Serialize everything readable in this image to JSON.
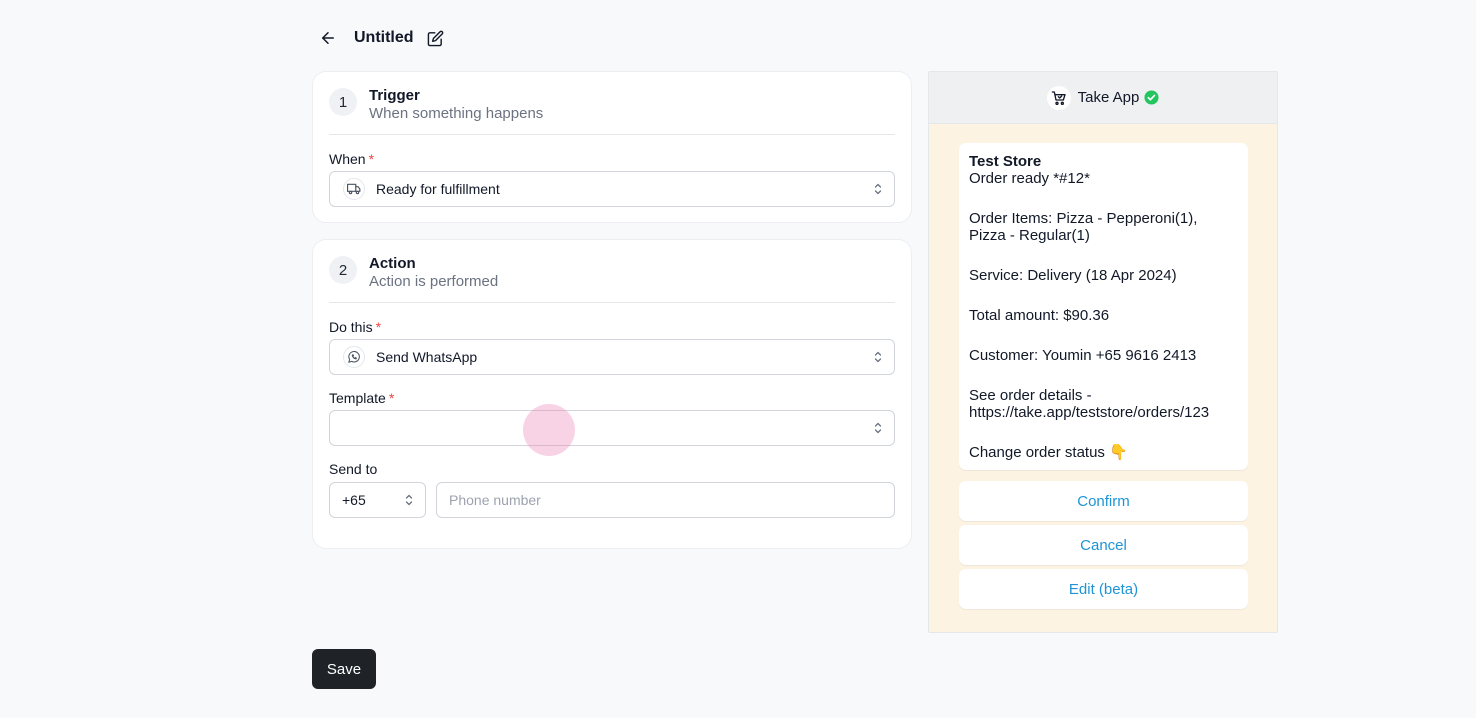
{
  "header": {
    "title": "Untitled"
  },
  "trigger": {
    "step_number": "1",
    "title": "Trigger",
    "subtitle": "When something happens",
    "when_label": "When",
    "required_mark": "*",
    "when_value": "Ready for fulfillment"
  },
  "action": {
    "step_number": "2",
    "title": "Action",
    "subtitle": "Action is performed",
    "do_this_label": "Do this",
    "required_mark": "*",
    "do_this_value": "Send WhatsApp",
    "template_label": "Template",
    "template_value": "",
    "send_to_label": "Send to",
    "country_code": "+65",
    "phone_placeholder": "Phone number"
  },
  "save_label": "Save",
  "preview": {
    "store_name": "Take App",
    "message": {
      "title": "Test Store",
      "line1": "Order ready *#12*",
      "items_line1": "Order Items: Pizza - Pepperoni(1),",
      "items_line2": "Pizza - Regular(1)",
      "service": "Service: Delivery (18 Apr 2024)",
      "total": "Total amount: $90.36",
      "customer": "Customer: Youmin +65 9616 2413",
      "details_label": "See order details -",
      "details_url": "https://take.app/teststore/orders/123",
      "change_status": "Change order status 👇"
    },
    "buttons": [
      "Confirm",
      "Cancel",
      "Edit (beta)"
    ]
  },
  "colors": {
    "accent_link": "#1e94d4",
    "verified": "#22c55e",
    "save_bg": "#1f2328",
    "preview_bg": "#fdf3e3",
    "required": "#ef4444"
  }
}
